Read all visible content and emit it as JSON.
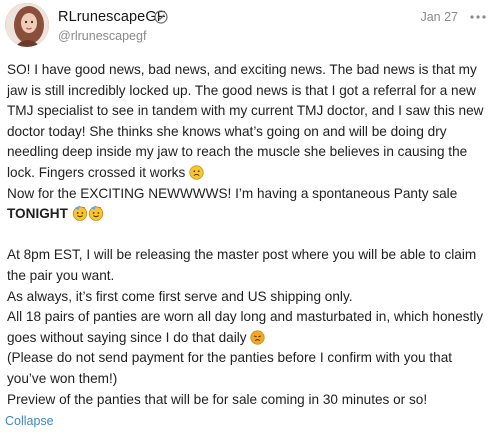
{
  "post": {
    "display_name": "RLrunescapeGF",
    "handle": "@rlrunescapegf",
    "date": "Jan 27",
    "icons": {
      "verified": "verified-badge-icon",
      "more": "more-options-icon",
      "avatar": "profile-avatar"
    },
    "body": {
      "p1": "SO! I have good news, bad news, and exciting news. The bad news is that my jaw is still incredibly locked up. The good news is that I got a referral for a new TMJ specialist to see in tandem with my current TMJ doctor, and I saw this new doctor today! She thinks she knows what’s going on and will be doing dry needling deep inside my jaw to reach the muscle she believes in causing the lock. Fingers crossed it works",
      "p2_start": "Now for the EXCITING NEWWWWS! I’m having a spontaneous Panty sale",
      "p2_bold": "TONIGHT",
      "p3": "At 8pm EST, I will be releasing the master post where you will be able to claim the pair you want.",
      "p4": "As always, it’s first come first serve and US shipping only.",
      "p5": "All 18 pairs of panties are worn all day long and masturbated in, which honestly goes without saying since I do that daily",
      "p6": "(Please do not send payment for the panties before I confirm with you that you’ve won them!)",
      "p7": "Preview of the panties that will be for sale coming in 30 minutes or so!"
    },
    "emoji": {
      "after_p1": "frowning-face-emoji",
      "after_tonight": "party-face-emoji",
      "after_p5": "disappointed-face-emoji"
    },
    "collapse_label": "Collapse"
  },
  "colors": {
    "link": "#3f88c5",
    "muted": "#8a8a8a",
    "text": "#1f1f1f",
    "emoji_yellow": "#f7c531"
  }
}
